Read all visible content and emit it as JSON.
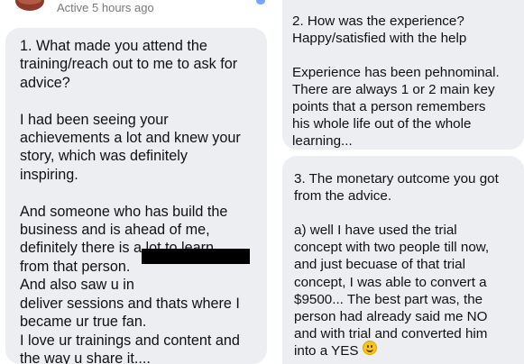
{
  "header": {
    "status": "Active 5 hours ago"
  },
  "messages": [
    {
      "text": "1. What made you attend the\ntraining/reach out to me to ask for\nadvice?\n\nI had been seeing your\nachievements a lot and knew your\nstory, which was definitely\ninspiring.\n\nAnd someone who has build the\nbusiness and is ahead of me,\ndefinitely there is a lot to learn\nfrom that person.\nAnd also saw u in\ndeliver sessions and thats where I\nbecame ur true fan.\nI love ur trainings and content and\nthe way u share it...."
    },
    {
      "text": "2. How was the experience?\nHappy/satisfied with the help\n\nExperience has been pehnominal.\nThere are always 1 or 2 main key\npoints that a person remembers\nhis whole life out of the whole\nlearning..."
    },
    {
      "text": "3. The monetary outcome you got\nfrom the advice.\n\na) well I have used the trial\nconcept with two people till now,\nand just becuase of that trial\nconcept, I was able to convert a\n$9500... The best part was, the\nperson had already said me NO\nand with trial and converted him\ninto a YES"
    }
  ],
  "icons": {
    "avatar": "profile-avatar",
    "emoji": "smiling-face-emoji"
  },
  "colors": {
    "bubble_background": "#edeef1",
    "status_text": "#7a7a7a",
    "redaction": "#000000"
  }
}
